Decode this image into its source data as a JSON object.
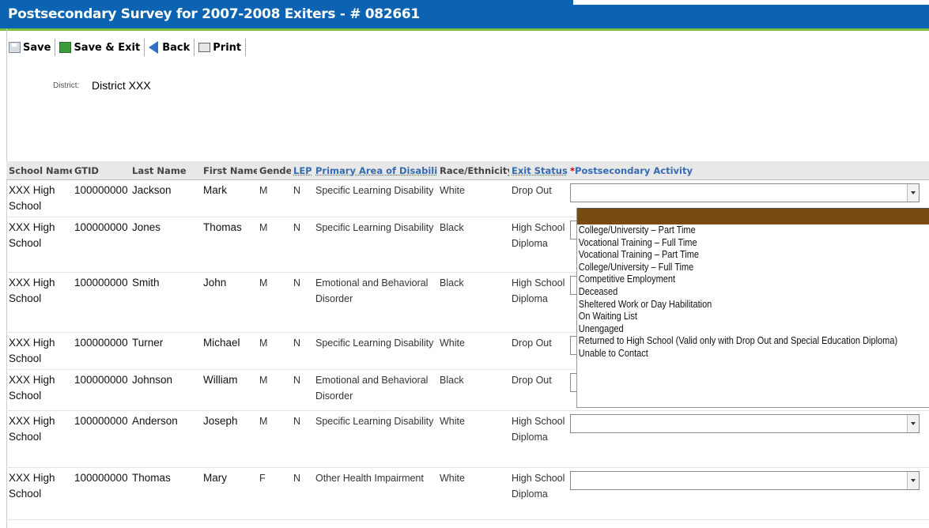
{
  "window": {
    "title": "Postsecondary Survey for 2007-2008 Exiters - # 082661"
  },
  "toolbar": {
    "save_label": "Save",
    "save_exit_label": "Save & Exit",
    "back_label": "Back",
    "print_label": "Print"
  },
  "district": {
    "label": "District:",
    "value": "District XXX"
  },
  "table": {
    "headers": {
      "school_name": "School Name",
      "gtid": "GTID",
      "last_name": "Last Name",
      "first_name": "First Name",
      "gender": "Gender",
      "lep": "LEP",
      "disability": "Primary Area of Disability",
      "race": "Race/Ethnicity",
      "exit_status": "Exit Status",
      "activity_star": "*",
      "activity": "Postsecondary Activity"
    },
    "rows": [
      {
        "school": "XXX High School",
        "gtid": "100000000",
        "last": "Jackson",
        "first": "Mark",
        "gender": "M",
        "lep": "N",
        "disability": "Specific Learning Disability",
        "race": "White",
        "exit": "Drop Out",
        "activity": ""
      },
      {
        "school": "XXX High School",
        "gtid": "100000000",
        "last": "Jones",
        "first": "Thomas",
        "gender": "M",
        "lep": "N",
        "disability": "Specific Learning Disability",
        "race": "Black",
        "exit": "High School Diploma",
        "activity": ""
      },
      {
        "school": "XXX High School",
        "gtid": "100000000",
        "last": "Smith",
        "first": "John",
        "gender": "M",
        "lep": "N",
        "disability": "Emotional and Behavioral Disorder",
        "race": "Black",
        "exit": "High School Diploma",
        "activity": ""
      },
      {
        "school": "XXX High School",
        "gtid": "100000000",
        "last": "Turner",
        "first": "Michael",
        "gender": "M",
        "lep": "N",
        "disability": "Specific Learning Disability",
        "race": "White",
        "exit": "Drop Out",
        "activity": ""
      },
      {
        "school": "XXX High School",
        "gtid": "100000000",
        "last": "Johnson",
        "first": "William",
        "gender": "M",
        "lep": "N",
        "disability": "Emotional and Behavioral Disorder",
        "race": "Black",
        "exit": "Drop Out",
        "activity": ""
      },
      {
        "school": "XXX High School",
        "gtid": "100000000",
        "last": "Anderson",
        "first": "Joseph",
        "gender": "M",
        "lep": "N",
        "disability": "Specific Learning Disability",
        "race": "White",
        "exit": "High School Diploma",
        "activity": ""
      },
      {
        "school": "XXX High School",
        "gtid": "100000000",
        "last": "Thomas",
        "first": "Mary",
        "gender": "F",
        "lep": "N",
        "disability": "Other Health Impairment",
        "race": "White",
        "exit": "High School Diploma",
        "activity": ""
      }
    ]
  },
  "dropdown": {
    "options": [
      "College/University – Part Time",
      "Vocational Training – Full Time",
      "Vocational Training – Part Time",
      "College/University – Full Time",
      "Competitive Employment",
      "Deceased",
      "Sheltered Work or Day Habilitation",
      "On Waiting List",
      "Unengaged",
      "Returned to High School (Valid only with Drop Out and Special Education Diploma)",
      "Unable to Contact"
    ]
  },
  "colors": {
    "title_bar": "#0b63b1",
    "accent_line": "#7cc33b",
    "highlight": "#7a4a14",
    "header_link": "#356bb0"
  }
}
